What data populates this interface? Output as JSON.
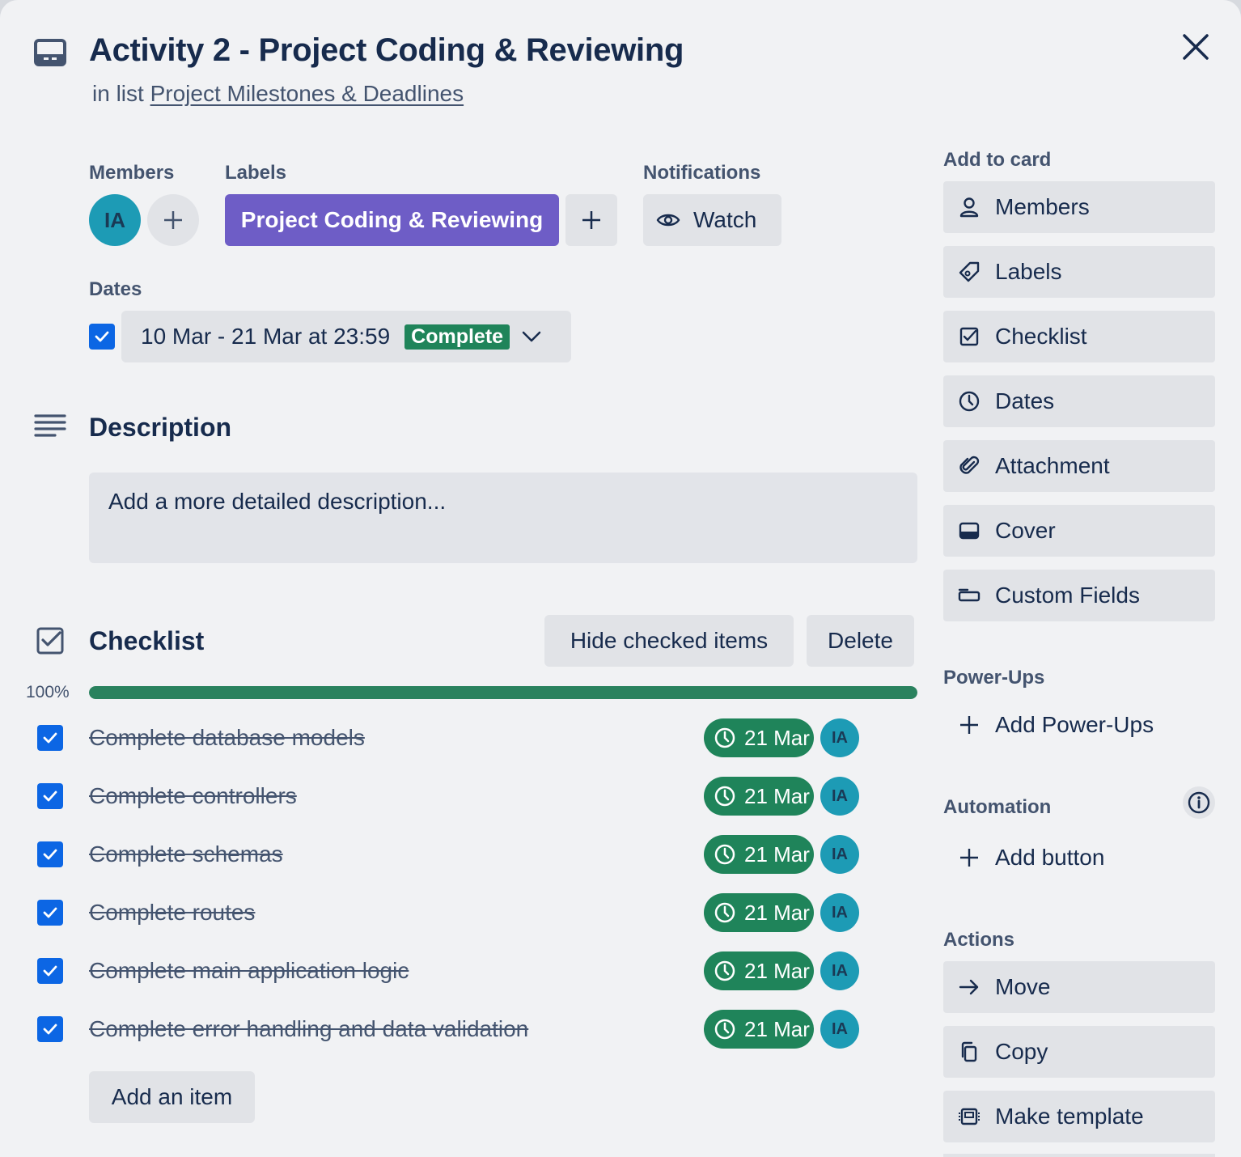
{
  "card": {
    "title": "Activity 2 - Project Coding & Reviewing",
    "list_prefix": "in list",
    "list_name": "Project Milestones & Deadlines"
  },
  "members": {
    "label": "Members",
    "initials": "IA"
  },
  "labels": {
    "label": "Labels",
    "items": [
      "Project Coding & Reviewing"
    ],
    "color": "#6e5dc6"
  },
  "notifications": {
    "label": "Notifications",
    "watch_label": "Watch"
  },
  "dates": {
    "label": "Dates",
    "range": "10 Mar - 21 Mar at 23:59",
    "status": "Complete",
    "checked": true
  },
  "description": {
    "title": "Description",
    "placeholder": "Add a more detailed description..."
  },
  "checklist": {
    "title": "Checklist",
    "hide_label": "Hide checked items",
    "delete_label": "Delete",
    "progress_text": "100%",
    "progress": 1.0,
    "add_item_label": "Add an item",
    "items": [
      {
        "text": "Complete database models",
        "due": "21 Mar",
        "assignee": "IA",
        "checked": true
      },
      {
        "text": "Complete controllers",
        "due": "21 Mar",
        "assignee": "IA",
        "checked": true
      },
      {
        "text": "Complete schemas",
        "due": "21 Mar",
        "assignee": "IA",
        "checked": true
      },
      {
        "text": "Complete routes",
        "due": "21 Mar",
        "assignee": "IA",
        "checked": true
      },
      {
        "text": "Complete main application logic",
        "due": "21 Mar",
        "assignee": "IA",
        "checked": true
      },
      {
        "text": "Complete error handling and data validation",
        "due": "21 Mar",
        "assignee": "IA",
        "checked": true
      }
    ]
  },
  "sidebar": {
    "add_to_card_title": "Add to card",
    "add_to_card": [
      {
        "label": "Members",
        "icon": "person-icon"
      },
      {
        "label": "Labels",
        "icon": "tag-icon"
      },
      {
        "label": "Checklist",
        "icon": "checklist-icon"
      },
      {
        "label": "Dates",
        "icon": "clock-icon"
      },
      {
        "label": "Attachment",
        "icon": "paperclip-icon"
      },
      {
        "label": "Cover",
        "icon": "cover-icon"
      },
      {
        "label": "Custom Fields",
        "icon": "custom-fields-icon"
      }
    ],
    "powerups_title": "Power-Ups",
    "add_powerups_label": "Add Power-Ups",
    "automation_title": "Automation",
    "add_button_label": "Add button",
    "actions_title": "Actions",
    "actions": [
      {
        "label": "Move",
        "icon": "arrow-right-icon"
      },
      {
        "label": "Copy",
        "icon": "copy-icon"
      },
      {
        "label": "Make template",
        "icon": "template-icon"
      }
    ]
  },
  "colors": {
    "accent": "#0c66e4",
    "success": "#1f845a",
    "avatar": "#1d9bb5",
    "label_purple": "#6e5dc6"
  }
}
